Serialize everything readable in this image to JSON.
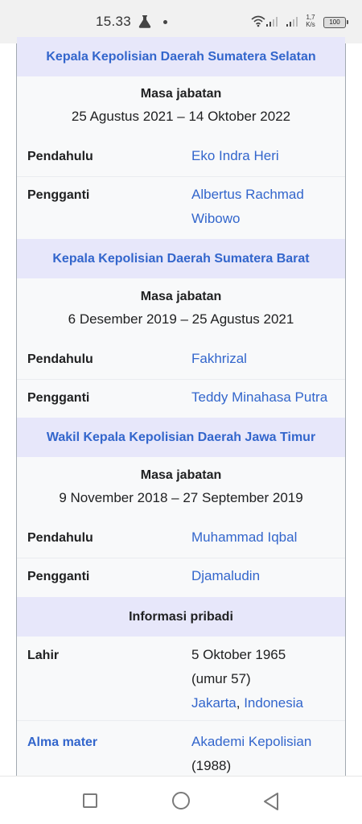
{
  "status_bar": {
    "time": "15.33",
    "net_speed_value": "1,7",
    "net_speed_unit": "K/s",
    "battery": "100"
  },
  "infobox": {
    "sections": [
      {
        "heading": "Kepala Kepolisian Daerah Sumatera Selatan",
        "term_label": "Masa jabatan",
        "term_dates": "25 Agustus 2021 – 14 Oktober 2022",
        "predecessor_label": "Pendahulu",
        "predecessor": "Eko Indra Heri",
        "successor_label": "Pengganti",
        "successor": "Albertus Rachmad Wibowo"
      },
      {
        "heading": "Kepala Kepolisian Daerah Sumatera Barat",
        "term_label": "Masa jabatan",
        "term_dates": "6 Desember 2019 – 25 Agustus 2021",
        "predecessor_label": "Pendahulu",
        "predecessor": "Fakhrizal",
        "successor_label": "Pengganti",
        "successor": "Teddy Minahasa Putra"
      },
      {
        "heading": "Wakil Kepala Kepolisian Daerah Jawa Timur",
        "term_label": "Masa jabatan",
        "term_dates": "9 November 2018 – 27 September 2019",
        "predecessor_label": "Pendahulu",
        "predecessor": "Muhammad Iqbal",
        "successor_label": "Pengganti",
        "successor": "Djamaludin"
      }
    ],
    "personal": {
      "heading": "Informasi pribadi",
      "born_label": "Lahir",
      "born_date": "5 Oktober 1965",
      "born_age": "(umur 57)",
      "born_city": "Jakarta",
      "born_sep": ", ",
      "born_country": "Indonesia",
      "alma_label": "Alma mater",
      "alma_value": "Akademi Kepolisian",
      "alma_year": "(1988)"
    }
  },
  "colors": {
    "link": "#3366cc",
    "header_bg": "#e7e7fa",
    "infobox_bg": "#f8f9fa"
  }
}
